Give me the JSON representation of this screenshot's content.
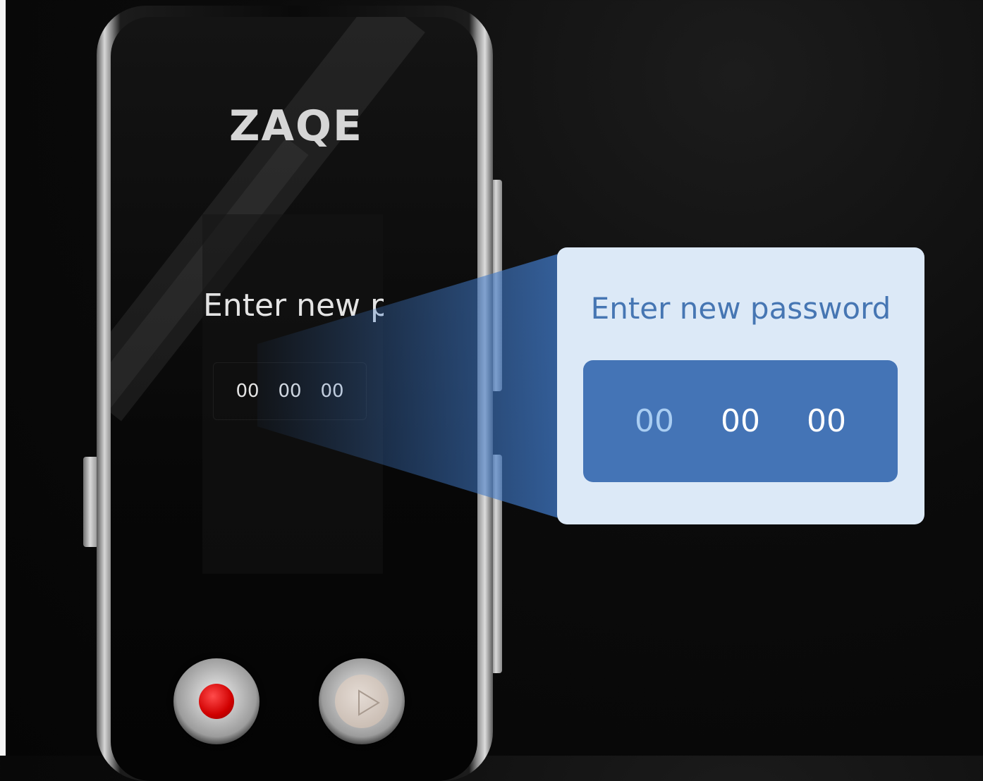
{
  "device": {
    "brand": "ZAQE",
    "screen_prompt": "Enter new p",
    "digits": [
      "00",
      "00",
      "00"
    ]
  },
  "callout": {
    "title": "Enter new password",
    "digits": [
      "00",
      "00",
      "00"
    ]
  },
  "colors": {
    "callout_background": "#dce9f7",
    "callout_box": "#4474b6",
    "callout_title": "#4676b3",
    "record_button": "#e00000"
  },
  "icons": [
    "record-icon",
    "play-icon"
  ]
}
